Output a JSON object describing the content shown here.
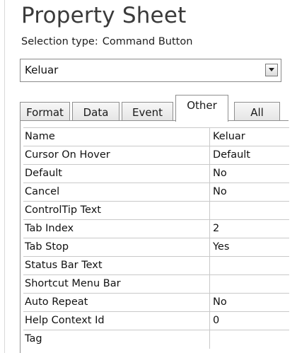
{
  "panel": {
    "title": "Property Sheet",
    "selection_label": "Selection type:",
    "selection_value": "Command Button"
  },
  "selector": {
    "value": "Keluar",
    "dropdown_icon": "chevron-down-icon"
  },
  "tabs": [
    {
      "label": "Format",
      "active": false
    },
    {
      "label": "Data",
      "active": false
    },
    {
      "label": "Event",
      "active": false
    },
    {
      "label": "Other",
      "active": true
    },
    {
      "label": "All",
      "active": false
    }
  ],
  "properties": [
    {
      "name": "Name",
      "value": "Keluar"
    },
    {
      "name": "Cursor On Hover",
      "value": "Default"
    },
    {
      "name": "Default",
      "value": "No"
    },
    {
      "name": "Cancel",
      "value": "No"
    },
    {
      "name": "ControlTip Text",
      "value": ""
    },
    {
      "name": "Tab Index",
      "value": "2"
    },
    {
      "name": "Tab Stop",
      "value": "Yes"
    },
    {
      "name": "Status Bar Text",
      "value": ""
    },
    {
      "name": "Shortcut Menu Bar",
      "value": ""
    },
    {
      "name": "Auto Repeat",
      "value": "No"
    },
    {
      "name": "Help Context Id",
      "value": "0"
    },
    {
      "name": "Tag",
      "value": ""
    }
  ]
}
